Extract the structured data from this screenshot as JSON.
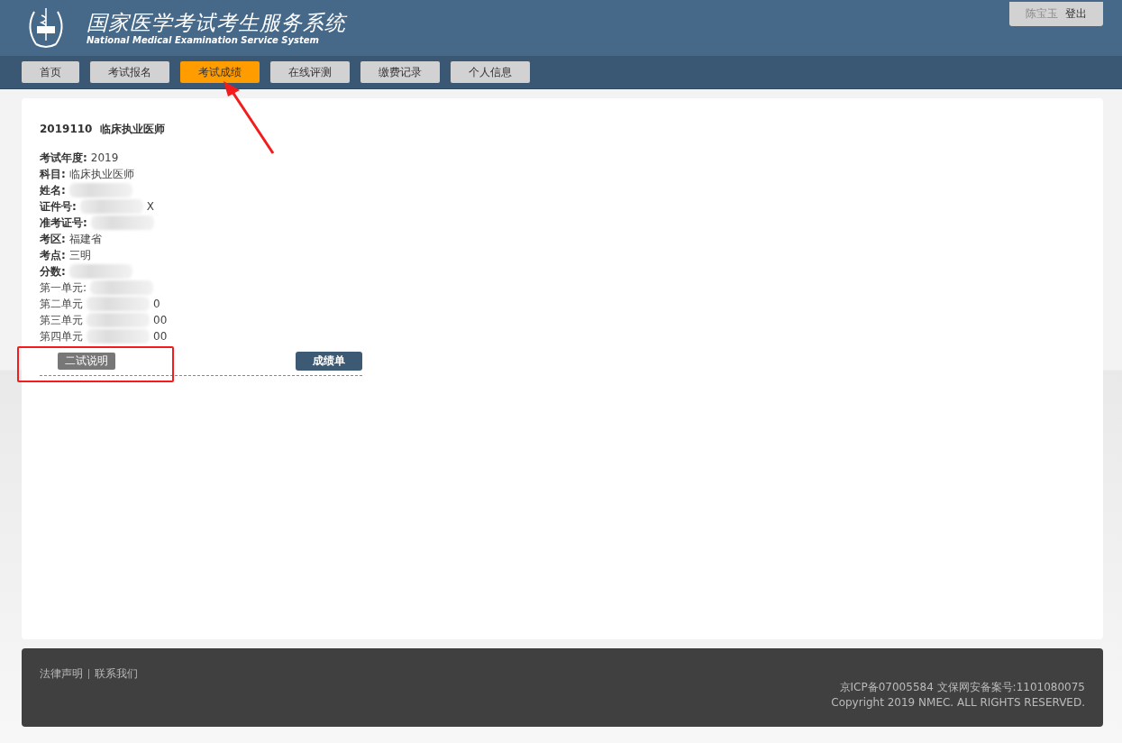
{
  "header": {
    "title": "国家医学考试考生服务系统",
    "subtitle": "National Medical Examination Service System",
    "user": "陈宝玉",
    "logout": "登出"
  },
  "nav": [
    {
      "label": "首页",
      "selected": false,
      "arrow_marked": false
    },
    {
      "label": "考试报名",
      "selected": false,
      "arrow_marked": false
    },
    {
      "label": "考试成绩",
      "selected": true,
      "arrow_marked": true
    },
    {
      "label": "在线评测",
      "selected": false,
      "arrow_marked": false
    },
    {
      "label": "缴费记录",
      "selected": false,
      "arrow_marked": false
    },
    {
      "label": "个人信息",
      "selected": false,
      "arrow_marked": false
    }
  ],
  "result": {
    "heading": "2019110  临床执业医师",
    "fields": [
      {
        "kind": "main",
        "label": "考试年度:",
        "value": "2019",
        "redacted": false
      },
      {
        "kind": "main",
        "label": "科目:",
        "value": "临床执业医师",
        "redacted": false
      },
      {
        "kind": "main",
        "label": "姓名:",
        "redacted": true
      },
      {
        "kind": "main",
        "label": "证件号:",
        "redacted": true,
        "tail": "X"
      },
      {
        "kind": "main",
        "label": "准考证号:",
        "redacted": true
      },
      {
        "kind": "main",
        "label": "考区:",
        "value": "福建省",
        "redacted": false
      },
      {
        "kind": "main",
        "label": "考点:",
        "value": "三明",
        "redacted": false
      },
      {
        "kind": "main",
        "label": "分数:",
        "redacted": true
      },
      {
        "kind": "unit",
        "label": "第一单元:",
        "redacted": true
      },
      {
        "kind": "unit",
        "label": "第二单元",
        "redacted": true,
        "tail": "0"
      },
      {
        "kind": "unit",
        "label": "第三单元",
        "redacted": true,
        "tail": "00"
      },
      {
        "kind": "unit",
        "label": "第四单元",
        "redacted": true,
        "tail": "00"
      }
    ],
    "note_button": "二试说明",
    "note_boxed": true,
    "report_button": "成绩单"
  },
  "footer": {
    "links": [
      {
        "label": "法律声明"
      },
      {
        "label": "联系我们"
      }
    ],
    "icp": "京ICP备07005584 文保网安备案号:1101080075",
    "copyright": "Copyright 2019 NMEC. ALL RIGHTS RESERVED."
  }
}
